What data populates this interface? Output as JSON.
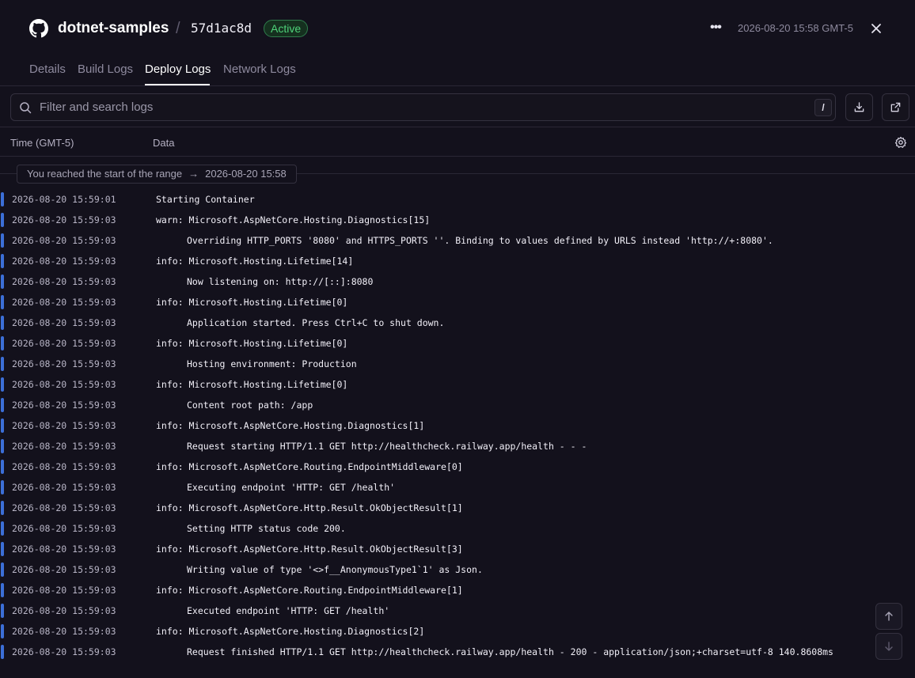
{
  "header": {
    "repo_name": "dotnet-samples",
    "separator": "/",
    "commit_hash": "57d1ac8d",
    "status_badge": "Active",
    "timestamp": "2026-08-20 15:58 GMT-5",
    "more_label": "•••"
  },
  "tabs": [
    {
      "label": "Details"
    },
    {
      "label": "Build Logs"
    },
    {
      "label": "Deploy Logs"
    },
    {
      "label": "Network Logs"
    }
  ],
  "active_tab": "Deploy Logs",
  "search": {
    "placeholder": "Filter and search logs",
    "value": "",
    "shortcut": "/"
  },
  "columns": {
    "time": "Time (GMT-5)",
    "data": "Data"
  },
  "range_notice": {
    "text": "You reached the start of the range",
    "arrow": "→",
    "time": "2026-08-20 15:58"
  },
  "colors": {
    "accent_bar": "#3c6fd8",
    "active_badge": "#4fd27a",
    "background": "#13111c"
  },
  "logs": [
    {
      "time": "2026-08-20 15:59:01",
      "message": "Starting Container",
      "indent": false
    },
    {
      "time": "2026-08-20 15:59:03",
      "message": "warn: Microsoft.AspNetCore.Hosting.Diagnostics[15]",
      "indent": false
    },
    {
      "time": "2026-08-20 15:59:03",
      "message": "Overriding HTTP_PORTS '8080' and HTTPS_PORTS ''. Binding to values defined by URLS instead 'http://+:8080'.",
      "indent": true
    },
    {
      "time": "2026-08-20 15:59:03",
      "message": "info: Microsoft.Hosting.Lifetime[14]",
      "indent": false
    },
    {
      "time": "2026-08-20 15:59:03",
      "message": "Now listening on: http://[::]:8080",
      "indent": true
    },
    {
      "time": "2026-08-20 15:59:03",
      "message": "info: Microsoft.Hosting.Lifetime[0]",
      "indent": false
    },
    {
      "time": "2026-08-20 15:59:03",
      "message": "Application started. Press Ctrl+C to shut down.",
      "indent": true
    },
    {
      "time": "2026-08-20 15:59:03",
      "message": "info: Microsoft.Hosting.Lifetime[0]",
      "indent": false
    },
    {
      "time": "2026-08-20 15:59:03",
      "message": "Hosting environment: Production",
      "indent": true
    },
    {
      "time": "2026-08-20 15:59:03",
      "message": "info: Microsoft.Hosting.Lifetime[0]",
      "indent": false
    },
    {
      "time": "2026-08-20 15:59:03",
      "message": "Content root path: /app",
      "indent": true
    },
    {
      "time": "2026-08-20 15:59:03",
      "message": "info: Microsoft.AspNetCore.Hosting.Diagnostics[1]",
      "indent": false
    },
    {
      "time": "2026-08-20 15:59:03",
      "message": "Request starting HTTP/1.1 GET http://healthcheck.railway.app/health - - -",
      "indent": true
    },
    {
      "time": "2026-08-20 15:59:03",
      "message": "info: Microsoft.AspNetCore.Routing.EndpointMiddleware[0]",
      "indent": false
    },
    {
      "time": "2026-08-20 15:59:03",
      "message": "Executing endpoint 'HTTP: GET /health'",
      "indent": true
    },
    {
      "time": "2026-08-20 15:59:03",
      "message": "info: Microsoft.AspNetCore.Http.Result.OkObjectResult[1]",
      "indent": false
    },
    {
      "time": "2026-08-20 15:59:03",
      "message": "Setting HTTP status code 200.",
      "indent": true
    },
    {
      "time": "2026-08-20 15:59:03",
      "message": "info: Microsoft.AspNetCore.Http.Result.OkObjectResult[3]",
      "indent": false
    },
    {
      "time": "2026-08-20 15:59:03",
      "message": "Writing value of type '<>f__AnonymousType1`1' as Json.",
      "indent": true
    },
    {
      "time": "2026-08-20 15:59:03",
      "message": "info: Microsoft.AspNetCore.Routing.EndpointMiddleware[1]",
      "indent": false
    },
    {
      "time": "2026-08-20 15:59:03",
      "message": "Executed endpoint 'HTTP: GET /health'",
      "indent": true
    },
    {
      "time": "2026-08-20 15:59:03",
      "message": "info: Microsoft.AspNetCore.Hosting.Diagnostics[2]",
      "indent": false
    },
    {
      "time": "2026-08-20 15:59:03",
      "message": "Request finished HTTP/1.1 GET http://healthcheck.railway.app/health - 200 - application/json;+charset=utf-8 140.8608ms",
      "indent": true
    }
  ],
  "icons": {
    "repo": "github-icon",
    "close": "close-icon",
    "search": "search-icon",
    "download": "download-icon",
    "open": "external-link-icon",
    "settings": "gear-icon",
    "scroll_up": "arrow-up-icon",
    "scroll_down": "arrow-down-icon"
  }
}
